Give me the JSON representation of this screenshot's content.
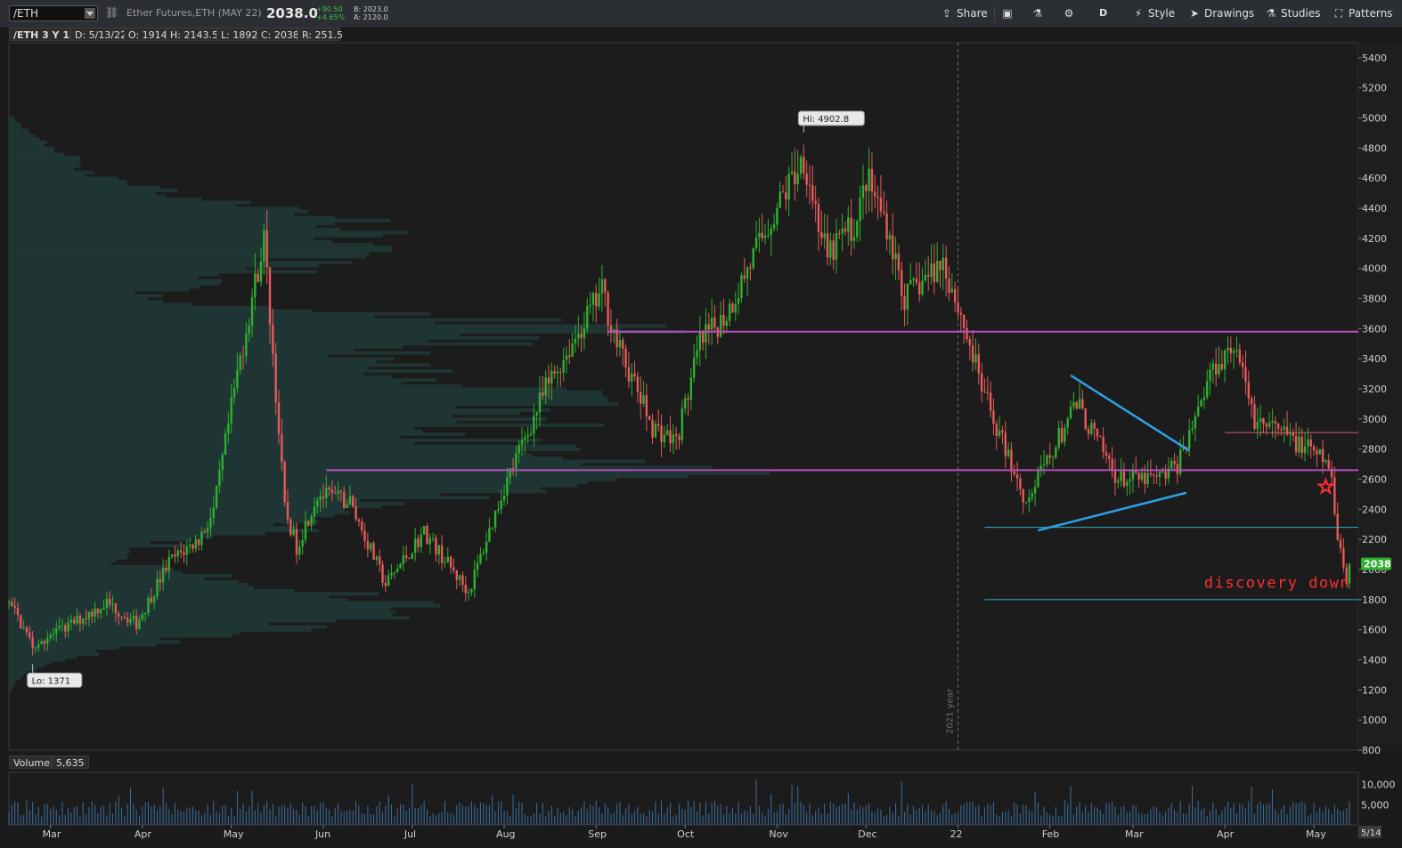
{
  "toolbar": {
    "symbol": "/ETH",
    "description": "Ether Futures,ETH (MAY 22)",
    "last_price": "2038.0",
    "net_change": "+90.50",
    "pct_change": "+4.65%",
    "bid": "B: 2023.0",
    "ask": "A: 2120.0",
    "buttons": {
      "share": "Share",
      "aggregation": "D",
      "style": "Style",
      "drawings": "Drawings",
      "studies": "Studies",
      "patterns": "Patterns"
    }
  },
  "infobar": {
    "title": "/ETH 3 Y 1D",
    "date": "D: 5/13/22",
    "open": "O: 1914",
    "high": "H: 2143.5",
    "low": "L: 1892",
    "close": "C: 2038",
    "range": "R: 251.5"
  },
  "volume_panel": {
    "label": "Volume",
    "value": "5,635"
  },
  "colors": {
    "up": "#2fb12f",
    "down": "#e85a5a",
    "level": "#b74fbf",
    "trend": "#2ea1e6",
    "support": "#2bb5c9",
    "annotation": "#ff3030",
    "profile": "#203a38"
  },
  "chart_data": {
    "type": "candlestick",
    "ylim": [
      800,
      5500
    ],
    "y_ticks": [
      "800",
      "1000",
      "1200",
      "1400",
      "1600",
      "1800",
      "2000",
      "2200",
      "2400",
      "2600",
      "2800",
      "3000",
      "3200",
      "3400",
      "3600",
      "3800",
      "4000",
      "4200",
      "4400",
      "4600",
      "4800",
      "5000",
      "5200",
      "5400"
    ],
    "x_ticks": [
      {
        "label": "Mar",
        "date": "2021-03-01"
      },
      {
        "label": "Apr",
        "date": "2021-04-01"
      },
      {
        "label": "May",
        "date": "2021-05-01"
      },
      {
        "label": "Jun",
        "date": "2021-06-01"
      },
      {
        "label": "Jul",
        "date": "2021-07-01"
      },
      {
        "label": "Aug",
        "date": "2021-08-01"
      },
      {
        "label": "Sep",
        "date": "2021-09-01"
      },
      {
        "label": "Oct",
        "date": "2021-10-01"
      },
      {
        "label": "Nov",
        "date": "2021-11-01"
      },
      {
        "label": "Dec",
        "date": "2021-12-01"
      },
      {
        "label": "22",
        "date": "2022-01-01"
      },
      {
        "label": "Feb",
        "date": "2022-02-01"
      },
      {
        "label": "Mar",
        "date": "2022-03-01"
      },
      {
        "label": "Apr",
        "date": "2022-04-01"
      },
      {
        "label": "May",
        "date": "2022-05-01"
      }
    ],
    "x_end_label": "5/14",
    "year_separator": {
      "date": "2022-01-01",
      "label": "2021 year"
    },
    "price_marker": {
      "value": 2038,
      "label": "2038"
    },
    "hi_label": {
      "date": "2021-11-10",
      "value": 4902.8,
      "label": "Hi: 4902.8"
    },
    "lo_label": {
      "date": "2021-02-23",
      "value": 1371,
      "label": "Lo: 1371"
    },
    "anchors": [
      [
        "2021-02-15",
        1780
      ],
      [
        "2021-02-23",
        1500
      ],
      [
        "2021-03-05",
        1600
      ],
      [
        "2021-03-20",
        1780
      ],
      [
        "2021-03-30",
        1640
      ],
      [
        "2021-04-10",
        2050
      ],
      [
        "2021-04-20",
        2200
      ],
      [
        "2021-04-25",
        2380
      ],
      [
        "2021-05-03",
        3300
      ],
      [
        "2021-05-10",
        4000
      ],
      [
        "2021-05-12",
        4200
      ],
      [
        "2021-05-19",
        2400
      ],
      [
        "2021-05-23",
        2150
      ],
      [
        "2021-05-30",
        2500
      ],
      [
        "2021-06-10",
        2450
      ],
      [
        "2021-06-22",
        1900
      ],
      [
        "2021-07-05",
        2250
      ],
      [
        "2021-07-20",
        1850
      ],
      [
        "2021-08-01",
        2550
      ],
      [
        "2021-08-15",
        3200
      ],
      [
        "2021-09-03",
        3850
      ],
      [
        "2021-09-08",
        3500
      ],
      [
        "2021-09-20",
        2950
      ],
      [
        "2021-09-28",
        2850
      ],
      [
        "2021-10-06",
        3500
      ],
      [
        "2021-10-15",
        3700
      ],
      [
        "2021-10-28",
        4250
      ],
      [
        "2021-11-10",
        4750
      ],
      [
        "2021-11-18",
        4050
      ],
      [
        "2021-11-22",
        4200
      ],
      [
        "2021-11-28",
        4300
      ],
      [
        "2021-12-01",
        4600
      ],
      [
        "2021-12-08",
        4300
      ],
      [
        "2021-12-14",
        3800
      ],
      [
        "2021-12-27",
        4050
      ],
      [
        "2022-01-01",
        3750
      ],
      [
        "2022-01-10",
        3150
      ],
      [
        "2022-01-24",
        2450
      ],
      [
        "2022-02-10",
        3100
      ],
      [
        "2022-02-24",
        2600
      ],
      [
        "2022-03-10",
        2600
      ],
      [
        "2022-03-16",
        2700
      ],
      [
        "2022-03-28",
        3350
      ],
      [
        "2022-04-04",
        3500
      ],
      [
        "2022-04-11",
        3000
      ],
      [
        "2022-04-25",
        2850
      ],
      [
        "2022-05-06",
        2700
      ],
      [
        "2022-05-09",
        2250
      ],
      [
        "2022-05-12",
        1900
      ],
      [
        "2022-05-13",
        2038
      ]
    ],
    "horizontal_levels": [
      {
        "value": 3580,
        "from": "2021-09-05",
        "to": "2022-05-16",
        "color": "#b74fbf",
        "width": 2
      },
      {
        "value": 2660,
        "from": "2021-06-02",
        "to": "2022-05-16",
        "color": "#b74fbf",
        "width": 2
      },
      {
        "value": 2910,
        "from": "2022-04-01",
        "to": "2022-05-16",
        "color": "#d35c7a",
        "width": 1
      },
      {
        "value": 2280,
        "from": "2022-01-10",
        "to": "2022-05-16",
        "color": "#2bb5c9",
        "width": 1
      },
      {
        "value": 1800,
        "from": "2022-01-10",
        "to": "2022-05-16",
        "color": "#2bb5c9",
        "width": 1
      }
    ],
    "trendlines": [
      {
        "from": [
          "2022-02-08",
          3290
        ],
        "to": [
          "2022-03-20",
          2790
        ],
        "color": "#2ea1e6"
      },
      {
        "from": [
          "2022-01-28",
          2260
        ],
        "to": [
          "2022-03-19",
          2510
        ],
        "color": "#2ea1e6"
      }
    ],
    "annotation": {
      "text": "discovery down",
      "date": "2022-03-25",
      "value": 1880,
      "color": "#ff3030"
    },
    "star_marker": {
      "date": "2022-05-05",
      "value": 2550
    },
    "volume": {
      "y_ticks": [
        "5,000",
        "10,000"
      ],
      "ylim": [
        0,
        13000
      ]
    }
  }
}
